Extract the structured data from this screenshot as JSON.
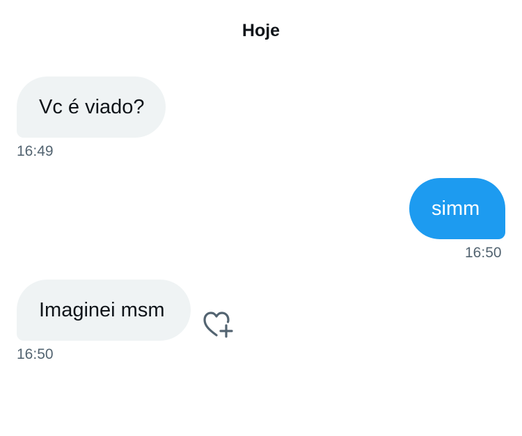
{
  "conversation": {
    "date_label": "Hoje",
    "messages": [
      {
        "direction": "received",
        "text": "Vc é viado?",
        "time": "16:49"
      },
      {
        "direction": "sent",
        "text": "simm",
        "time": "16:50"
      },
      {
        "direction": "received",
        "text": "Imaginei msm",
        "time": "16:50",
        "reaction_icon": "heart-plus-icon"
      }
    ]
  },
  "colors": {
    "sent_bubble": "#1d9bf0",
    "received_bubble": "#eff3f4",
    "timestamp": "#536471",
    "text": "#0f1419"
  }
}
